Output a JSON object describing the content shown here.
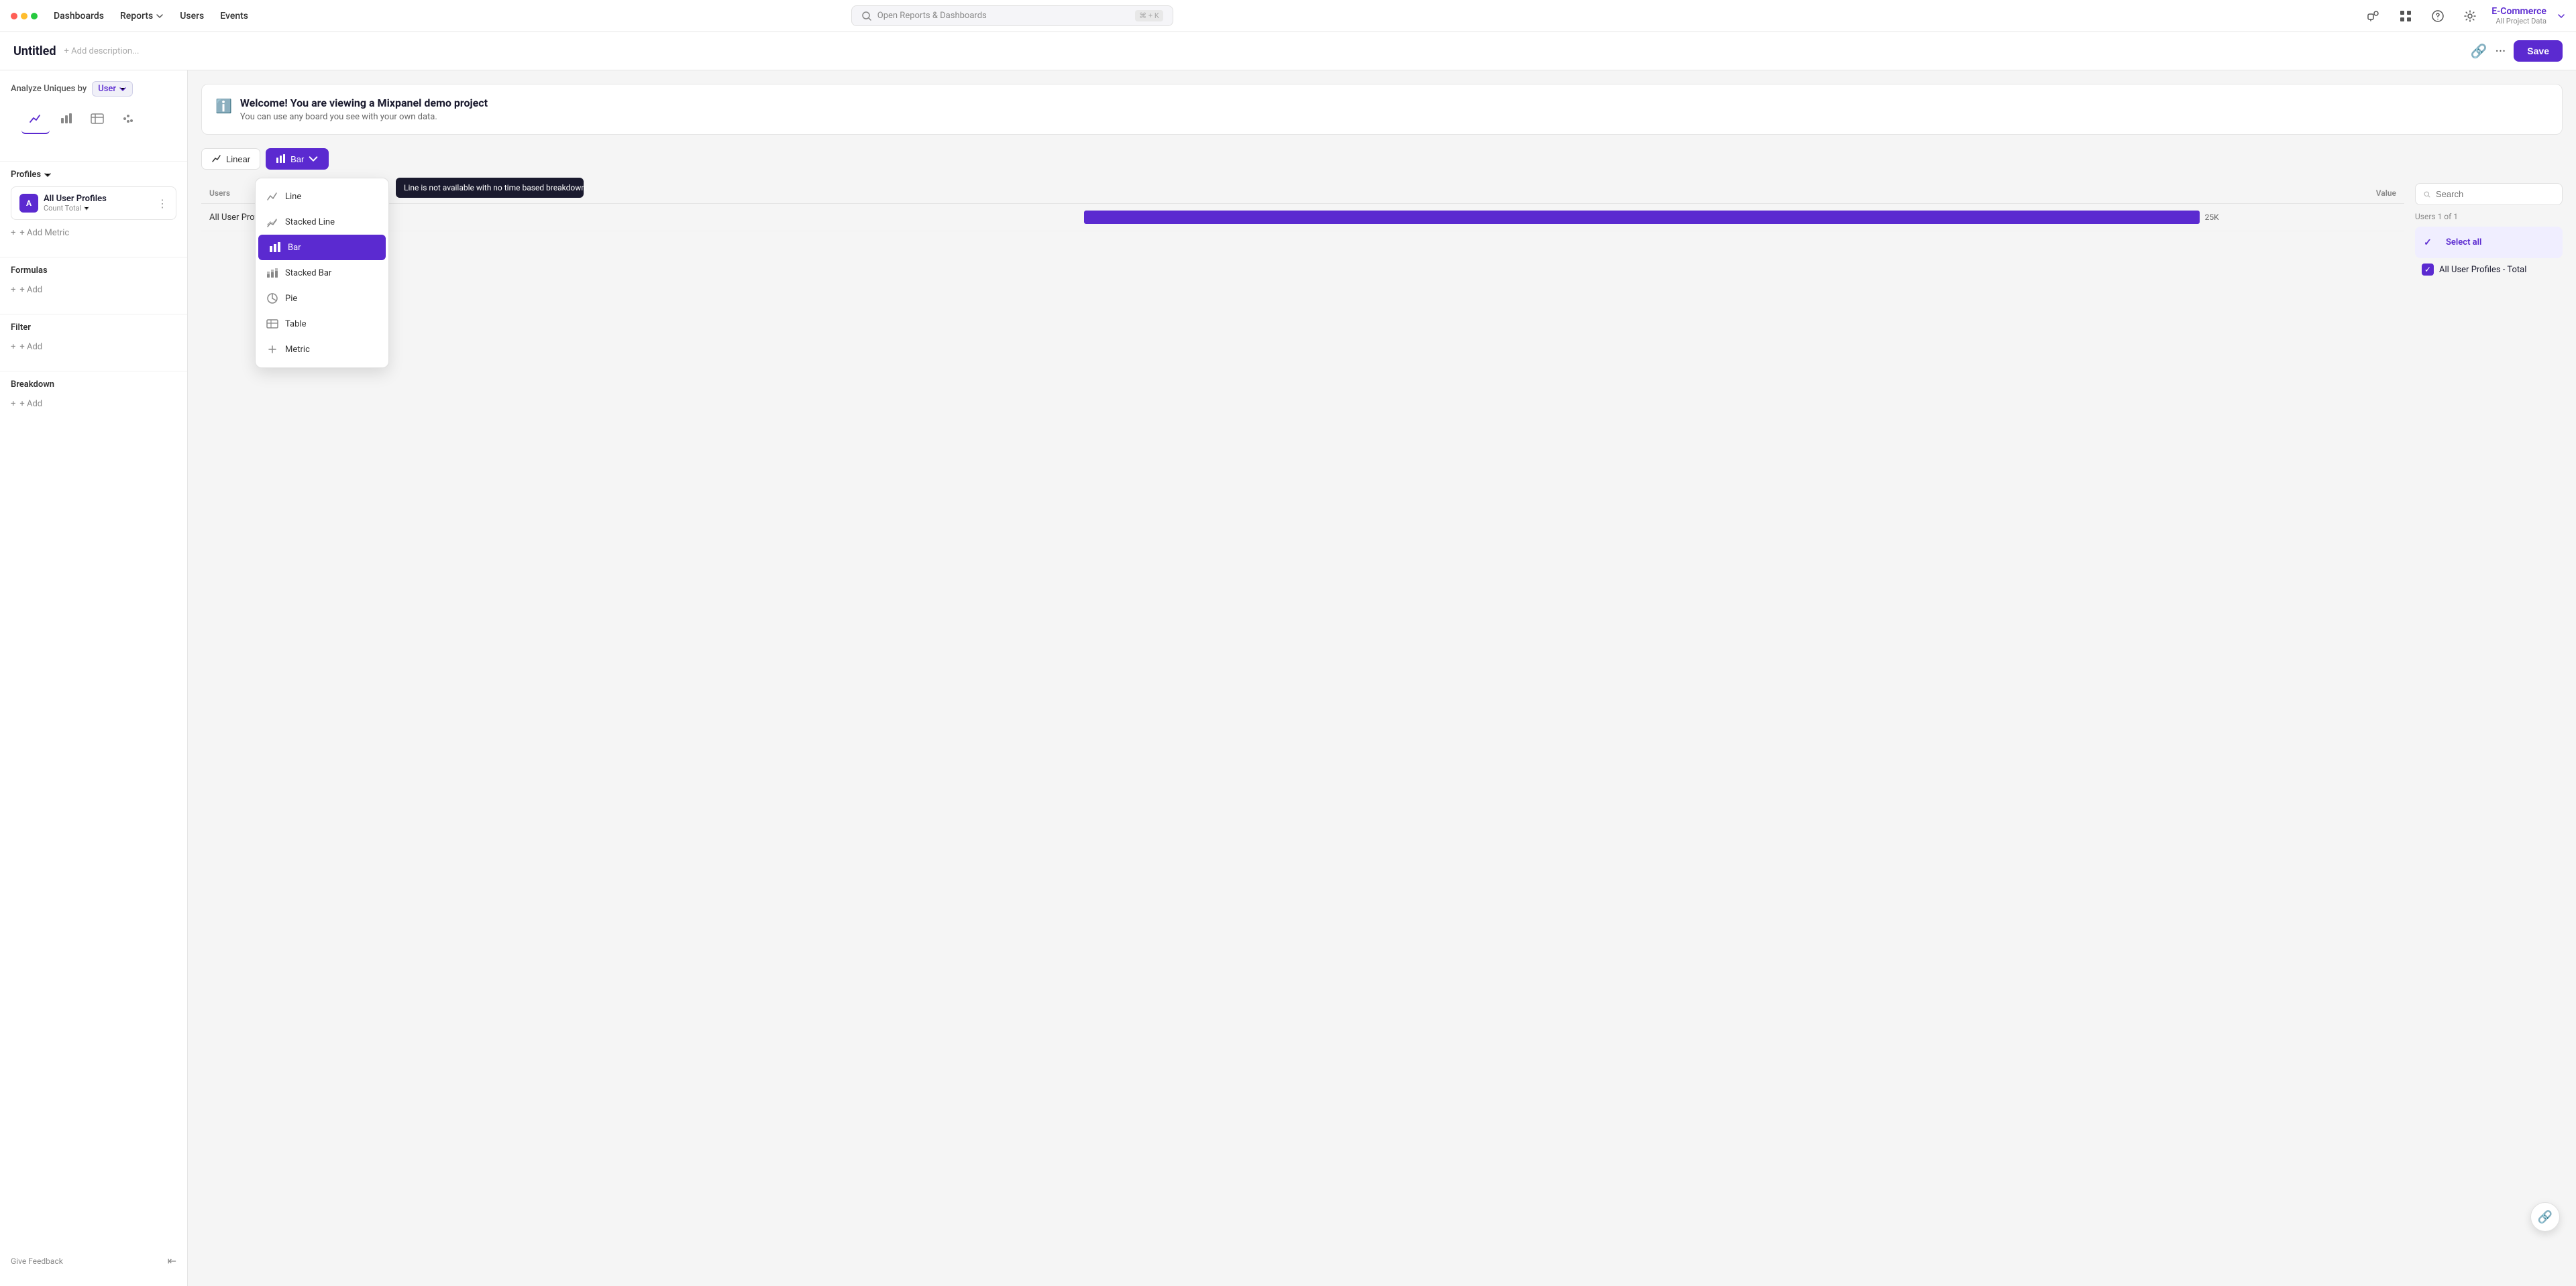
{
  "nav": {
    "dots": [
      "red",
      "yellow",
      "green"
    ],
    "links": [
      "Dashboards",
      "Reports",
      "Users",
      "Events"
    ],
    "search_placeholder": "Open Reports & Dashboards",
    "search_shortcut": "⌘ + K",
    "project_name": "E-Commerce",
    "project_sub": "All Project Data"
  },
  "page": {
    "title": "Untitled",
    "add_desc": "+ Add description..."
  },
  "toolbar": {
    "save_label": "Save"
  },
  "sidebar": {
    "analyze_label": "Analyze Uniques by",
    "user_selector": "User",
    "profiles_label": "Profiles",
    "metric_name": "All User Profiles",
    "metric_sub": "Count Total",
    "add_metric": "+ Add Metric",
    "formulas_label": "Formulas",
    "add_formula": "+ Add",
    "filter_label": "Filter",
    "add_filter": "+ Add",
    "breakdown_label": "Breakdown",
    "add_breakdown": "+ Add",
    "feedback": "Give Feedback"
  },
  "welcome": {
    "title": "Welcome! You are viewing a Mixpanel demo project",
    "sub": "You can use any board you see with your own data."
  },
  "chart_toolbar": {
    "linear_label": "Linear",
    "bar_label": "Bar"
  },
  "dropdown": {
    "items": [
      {
        "id": "line",
        "label": "Line",
        "icon": "line"
      },
      {
        "id": "stacked-line",
        "label": "Stacked Line",
        "icon": "stacked-line"
      },
      {
        "id": "bar",
        "label": "Bar",
        "icon": "bar",
        "active": true
      },
      {
        "id": "stacked-bar",
        "label": "Stacked Bar",
        "icon": "stacked-bar"
      },
      {
        "id": "pie",
        "label": "Pie",
        "icon": "pie"
      },
      {
        "id": "table",
        "label": "Table",
        "icon": "table"
      },
      {
        "id": "metric",
        "label": "Metric",
        "icon": "metric"
      }
    ]
  },
  "tooltip": {
    "text": "Line is not available with no time based breakdown."
  },
  "table": {
    "col_users": "Users",
    "col_value": "Value",
    "row_label": "All User Profiles - T...",
    "row_value": "25K",
    "bar_width_pct": 95
  },
  "right_panel": {
    "search_placeholder": "Search",
    "users_count": "Users 1 of 1",
    "select_all": "Select all",
    "items": [
      {
        "label": "All User Profiles - Total",
        "checked": true
      }
    ]
  },
  "fab": {
    "icon": "🔗"
  }
}
